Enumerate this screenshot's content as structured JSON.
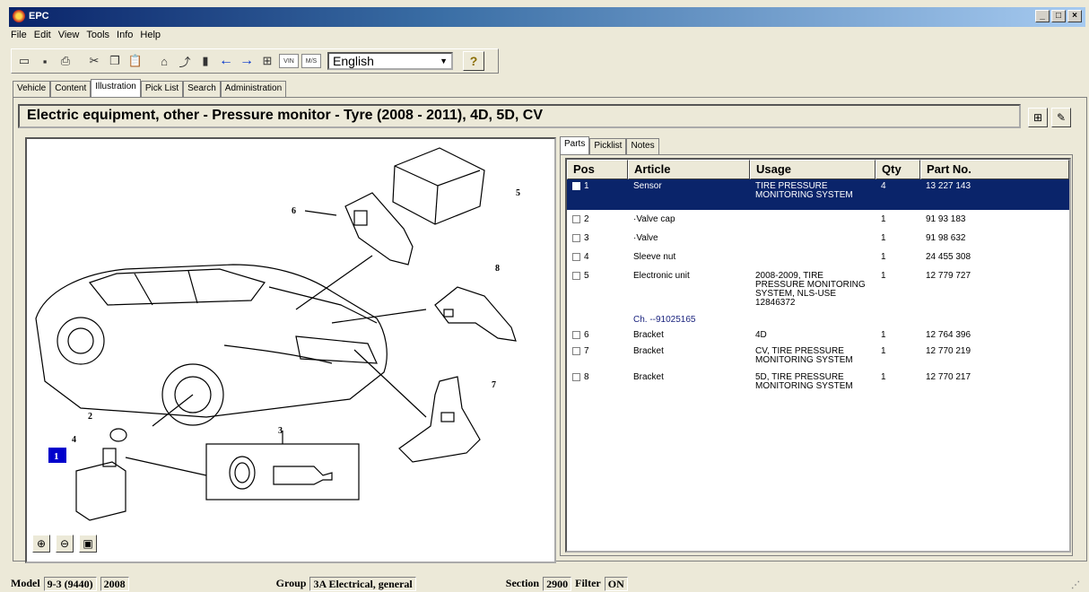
{
  "window": {
    "title": "EPC",
    "minimize": "_",
    "maximize": "□",
    "close": "×"
  },
  "menu": [
    "File",
    "Edit",
    "View",
    "Tools",
    "Info",
    "Help"
  ],
  "toolbar": {
    "language": "English",
    "vin_label": "VIN",
    "ms_label": "M/S"
  },
  "tabs": [
    "Vehicle",
    "Content",
    "Illustration",
    "Pick List",
    "Search",
    "Administration"
  ],
  "active_tab": "Illustration",
  "header": {
    "title": "Electric equipment, other - Pressure monitor - Tyre   (2008 - 2011), 4D, 5D, CV"
  },
  "subtabs": [
    "Parts",
    "Picklist",
    "Notes"
  ],
  "table": {
    "columns": [
      "Pos",
      "Article",
      "Usage",
      "Qty",
      "Part No."
    ],
    "rows": [
      {
        "pos": "1",
        "article": "Sensor",
        "usage": "TIRE PRESSURE MONITORING SYSTEM",
        "qty": "4",
        "part": "13 227 143",
        "selected": true
      },
      {
        "pos": "2",
        "article": "·Valve cap",
        "usage": "",
        "qty": "1",
        "part": "91 93 183"
      },
      {
        "pos": "3",
        "article": "·Valve",
        "usage": "",
        "qty": "1",
        "part": "91 98 632"
      },
      {
        "pos": "4",
        "article": "Sleeve nut",
        "usage": "",
        "qty": "1",
        "part": "24 455 308"
      },
      {
        "pos": "5",
        "article": "Electronic unit",
        "usage": "2008-2009, TIRE PRESSURE MONITORING SYSTEM, NLS-USE 12846372",
        "qty": "1",
        "part": "12 779 727",
        "note": "Ch. --91025165"
      },
      {
        "pos": "6",
        "article": "Bracket",
        "usage": "4D",
        "qty": "1",
        "part": "12 764 396"
      },
      {
        "pos": "7",
        "article": "Bracket",
        "usage": "CV, TIRE PRESSURE MONITORING SYSTEM",
        "qty": "1",
        "part": "12 770 219"
      },
      {
        "pos": "8",
        "article": "Bracket",
        "usage": "5D, TIRE PRESSURE MONITORING SYSTEM",
        "qty": "1",
        "part": "12 770 217"
      }
    ]
  },
  "illustration": {
    "callouts": [
      "1",
      "2",
      "3",
      "4",
      "5",
      "6",
      "7",
      "8"
    ],
    "highlighted": "1"
  },
  "status": {
    "model_label": "Model",
    "model_value": "9-3 (9440)",
    "year": "2008",
    "group_label": "Group",
    "group_value": "3A Electrical, general",
    "section_label": "Section",
    "section_value": "2900",
    "filter_label": "Filter",
    "filter_value": "ON"
  }
}
